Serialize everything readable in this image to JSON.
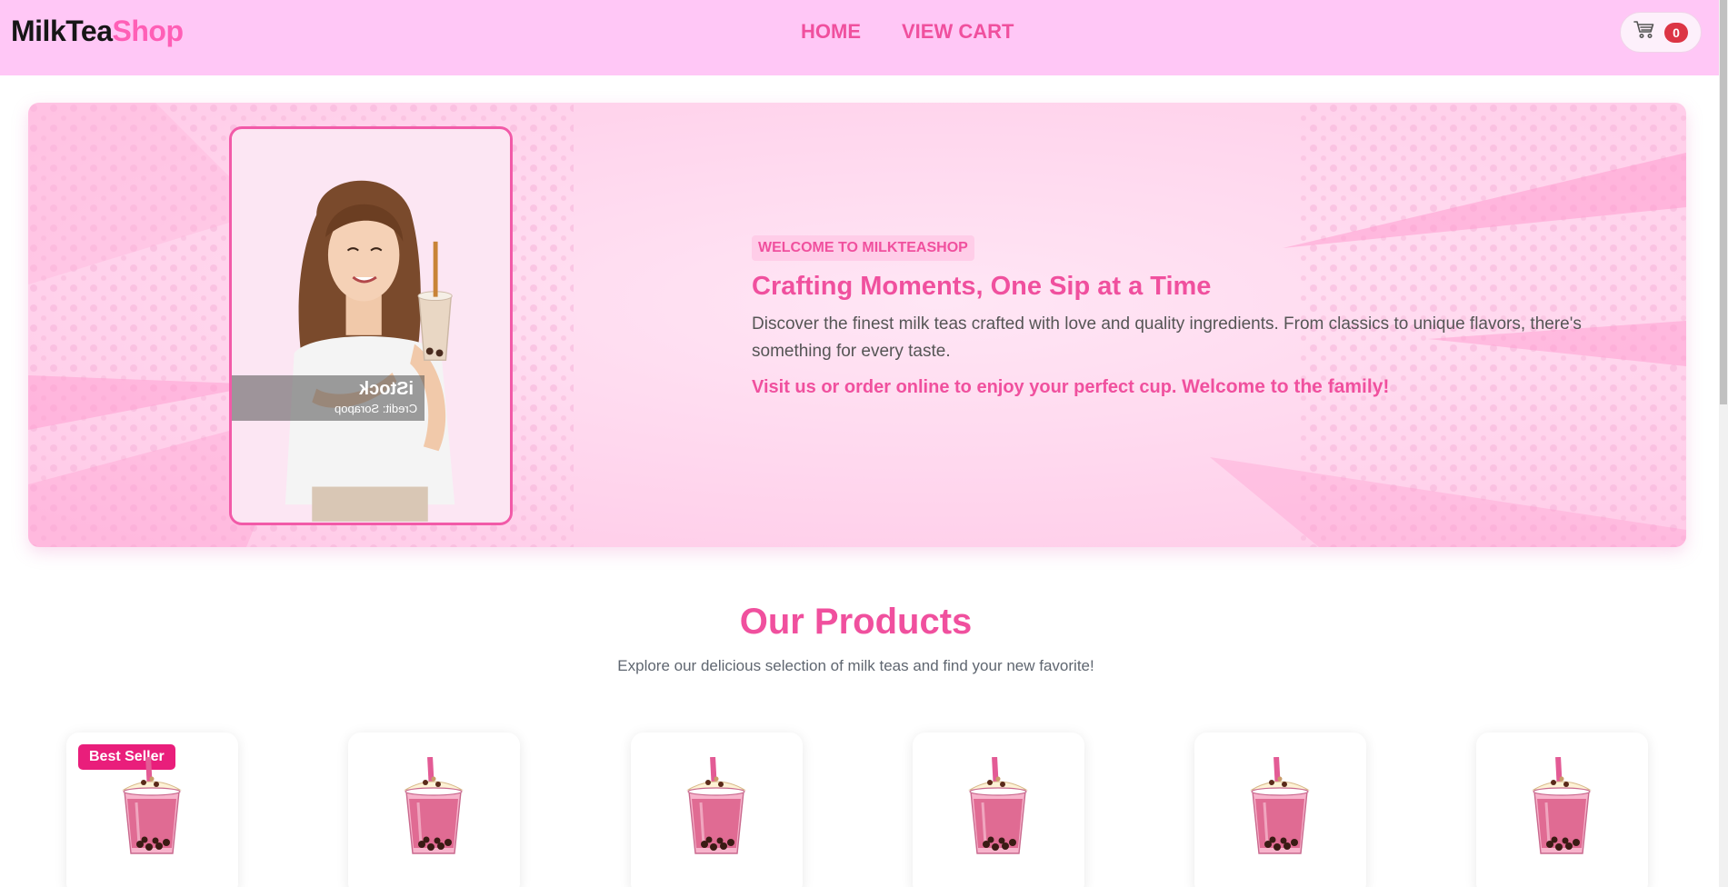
{
  "navbar": {
    "brand_part1": "MilkTea",
    "brand_part2": "Shop",
    "links": [
      "HOME",
      "VIEW CART"
    ],
    "cart_count": "0",
    "cart_icon": "cart-icon"
  },
  "hero": {
    "image_watermark_brand": "iStock",
    "image_watermark_credit": "Credit: Sorapop",
    "badge": "WELCOME TO MILKTEASHOP",
    "title": "Crafting Moments, One Sip at a Time",
    "description": "Discover the finest milk teas crafted with love and quality ingredients. From classics to unique flavors, there's something for every taste.",
    "cta_text": "Visit us or order online to enjoy your perfect cup.",
    "cta_strong": "Welcome to the family!"
  },
  "products": {
    "title": "Our Products",
    "subtitle": "Explore our delicious selection of milk teas and find your new favorite!",
    "cards": [
      {
        "badge": "Best Seller"
      },
      {
        "badge": ""
      },
      {
        "badge": ""
      },
      {
        "badge": ""
      },
      {
        "badge": ""
      },
      {
        "badge": ""
      }
    ]
  },
  "colors": {
    "accent": "#f0509e",
    "nav_bg": "#ffc7f6",
    "badge_bg": "#e91e7b"
  }
}
